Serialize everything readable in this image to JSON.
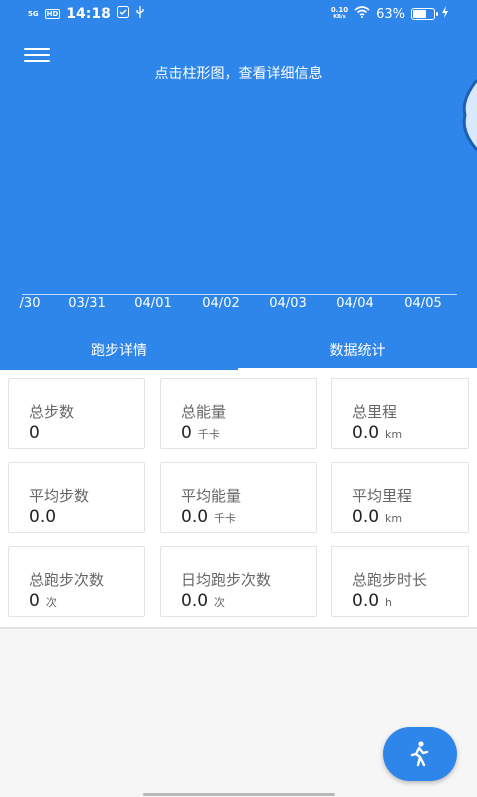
{
  "status_bar": {
    "network": "5G",
    "signal_hd": "HD",
    "time": "14:18",
    "speed_value": "0.10",
    "speed_unit": "KB/s",
    "battery": "63%",
    "battery_level": 0.63
  },
  "header": {
    "hint": "点击柱形图，查看详细信息",
    "x_ticks": [
      "/30",
      "03/31",
      "04/01",
      "04/02",
      "04/03",
      "04/04",
      "04/05"
    ]
  },
  "tabs": [
    {
      "label": "跑步详情",
      "selected": false
    },
    {
      "label": "数据统计",
      "selected": true
    }
  ],
  "stats": [
    {
      "label": "总步数",
      "value": "0",
      "unit": ""
    },
    {
      "label": "总能量",
      "value": "0",
      "unit": "千卡"
    },
    {
      "label": "总里程",
      "value": "0.0",
      "unit": "km"
    },
    {
      "label": "平均步数",
      "value": "0.0",
      "unit": ""
    },
    {
      "label": "平均能量",
      "value": "0.0",
      "unit": "千卡"
    },
    {
      "label": "平均里程",
      "value": "0.0",
      "unit": "km"
    },
    {
      "label": "总跑步次数",
      "value": "0",
      "unit": "次"
    },
    {
      "label": "日均跑步次数",
      "value": "0.0",
      "unit": "次"
    },
    {
      "label": "总跑步时长",
      "value": "0.0",
      "unit": "h"
    }
  ],
  "colors": {
    "primary": "#2f86ea",
    "background": "#f6f6f6"
  },
  "icons": {
    "menu": "hamburger-menu-icon",
    "fab": "running-person-icon"
  }
}
